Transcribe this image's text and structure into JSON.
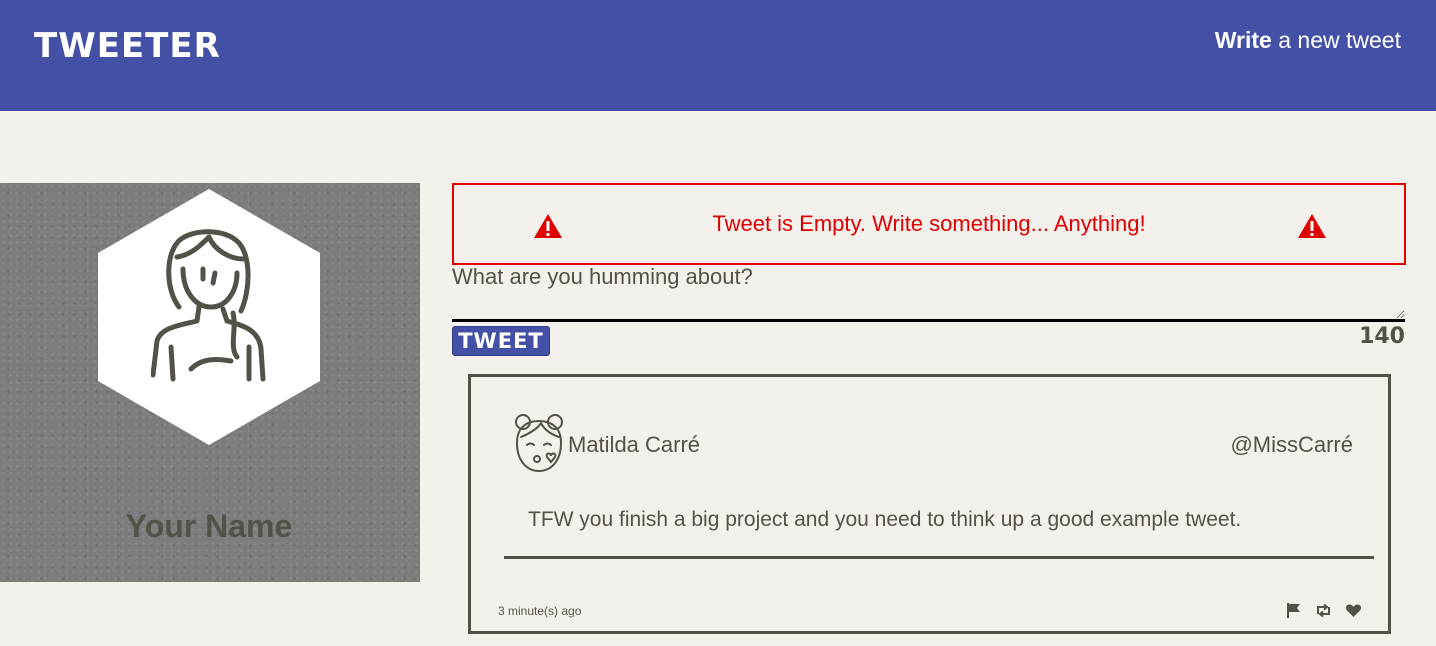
{
  "header": {
    "brand": "TWEETER",
    "compose_bold": "Write",
    "compose_rest": "a new tweet"
  },
  "profile": {
    "name": "Your Name"
  },
  "composer": {
    "error_message": "Tweet is Empty. Write something... Anything!",
    "placeholder": "What are you humming about?",
    "tweet_button": "TWEET",
    "char_count": "140"
  },
  "tweets": [
    {
      "author": "Matilda Carré",
      "handle": "@MissCarré",
      "text": "TFW you finish a big project and you need to think up a good example tweet.",
      "time": "3 minute(s) ago"
    }
  ],
  "colors": {
    "nav": "#4350a5",
    "background": "#f4f1ec",
    "error": "#e00000",
    "text": "#545149"
  },
  "icons": {
    "warning": "warning-triangle-icon",
    "flag": "flag-icon",
    "retweet": "retweet-icon",
    "like": "heart-icon"
  }
}
